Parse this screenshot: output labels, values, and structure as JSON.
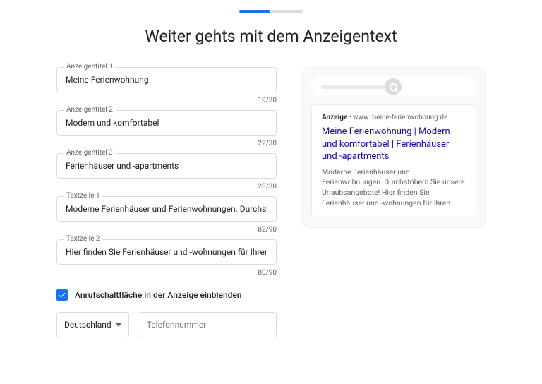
{
  "page_title": "Weiter gehts mit dem Anzeigentext",
  "fields": {
    "headline1": {
      "label": "Anzeigentitel 1",
      "value": "Meine Ferienwohnung",
      "counter": "19/30"
    },
    "headline2": {
      "label": "Anzeigentitel 2",
      "value": "Modern und komfortabel",
      "counter": "22/30"
    },
    "headline3": {
      "label": "Anzeigentitel 3",
      "value": "Ferienhäuser und -apartments",
      "counter": "28/30"
    },
    "desc1": {
      "label": "Textzeile 1",
      "value": "Moderne Ferienhäuser und Ferienwohnungen. Durchstöbern S",
      "counter": "82/90"
    },
    "desc2": {
      "label": "Textzeile 2",
      "value": "Hier finden Sie Ferienhäuser und -wohnungen für Ihren Urlaub.",
      "counter": "80/90"
    }
  },
  "call_checkbox_label": "Anrufschaltfläche in der Anzeige einblenden",
  "country": "Deutschland",
  "phone_placeholder": "Telefonnummer",
  "preview": {
    "ad_badge": "Anzeige",
    "url": "www.meine-ferienwohnung.de",
    "headline": "Meine Ferienwohnung | Modern und komfortabel | Ferienhäuser und -apartments",
    "description": "Moderne Ferienhäuser und Ferienwohnungen. Durchstöbern Sie unsere Urlaubsangebote! Hier finden Sie Ferienhäuser und -wohnungen für Ihren…"
  }
}
